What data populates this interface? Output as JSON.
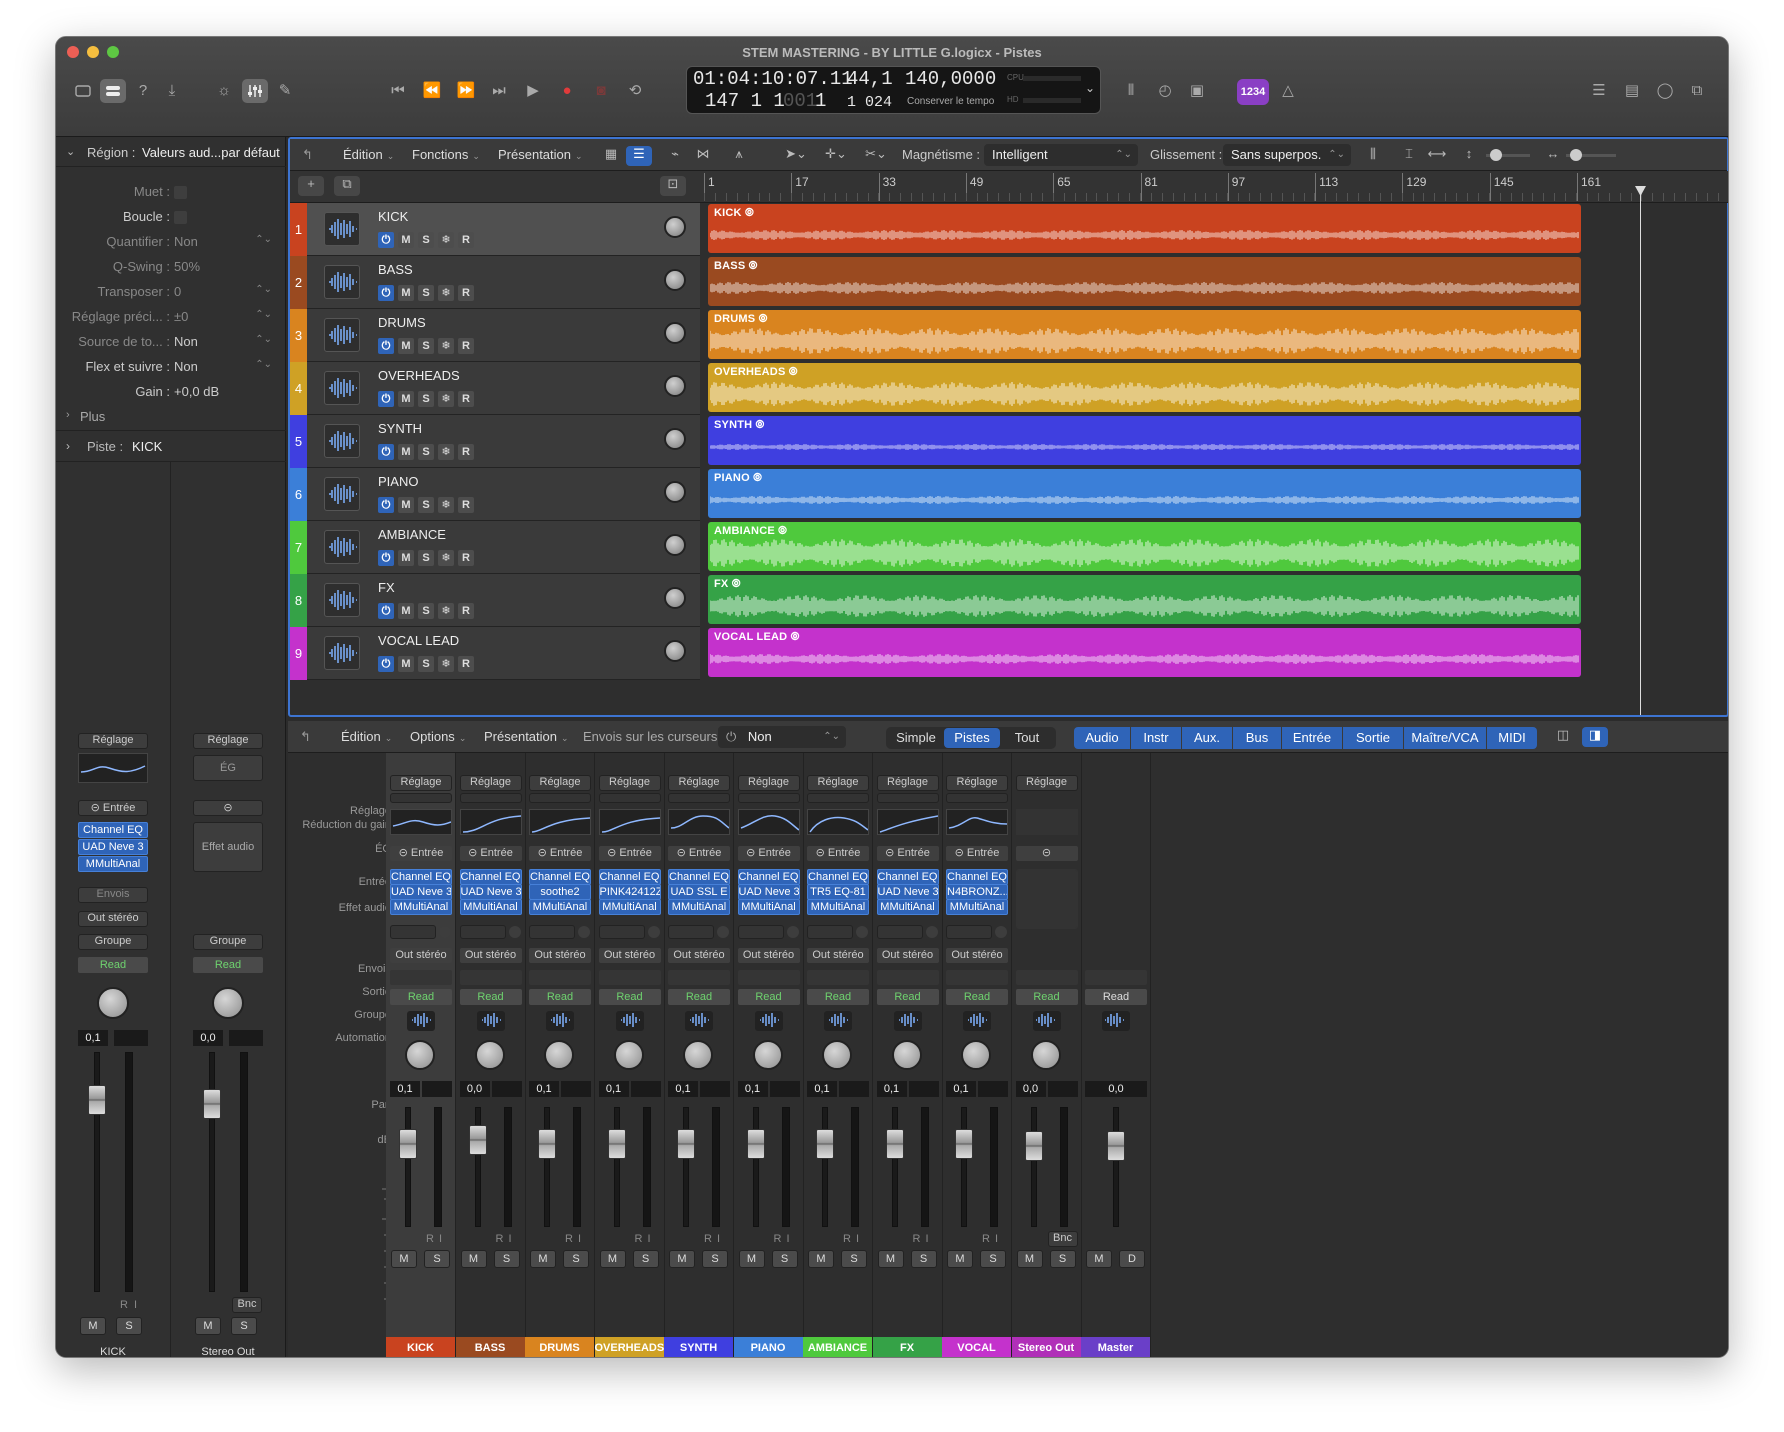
{
  "window": {
    "title": "STEM MASTERING - BY LITTLE G.logicx - Pistes"
  },
  "lcd": {
    "time": "01:04:10:07.11",
    "bars": "147  1  1   001  1",
    "bars_main": "147  1  1",
    "bars_sub": "001",
    "bars_end": "1",
    "key": "44,1",
    "div": "1 024",
    "tempo": "140,0000",
    "tempo_sub": "Conserver le tempo",
    "cpu": "CPU",
    "hd": "HD"
  },
  "toolbar": {
    "count_in": "1234"
  },
  "inspector": {
    "region_header": "Région :",
    "region_name": "Valeurs aud...par défaut",
    "rows": [
      {
        "label": "Muet :",
        "value": ""
      },
      {
        "label": "Boucle :",
        "value": ""
      },
      {
        "label": "Quantifier :",
        "value": "Non"
      },
      {
        "label": "Q-Swing :",
        "value": "50%"
      },
      {
        "label": "Transposer :",
        "value": "0"
      },
      {
        "label": "Réglage préci... :",
        "value": "±0"
      },
      {
        "label": "Source de to... :",
        "value": "Non"
      },
      {
        "label": "Flex et suivre :",
        "value": "Non"
      },
      {
        "label": "Gain :",
        "value": "+0,0 dB"
      }
    ],
    "plus": "Plus",
    "track_header": "Piste :",
    "track_name": "KICK",
    "strip1": {
      "setting": "Réglage",
      "input": "Entrée",
      "plugins": [
        "Channel EQ",
        "UAD Neve 3",
        "MMultiAnal"
      ],
      "sends": "Envois",
      "output": "Out stéréo",
      "group": "Groupe",
      "auto": "Read",
      "vol": "0,1",
      "r": "R",
      "i": "I",
      "m": "M",
      "s": "S",
      "name": "KICK"
    },
    "strip2": {
      "setting": "Réglage",
      "eq": "ÉG",
      "effect": "Effet audio",
      "group": "Groupe",
      "auto": "Read",
      "vol": "0,0",
      "bnc": "Bnc",
      "m": "M",
      "s": "S",
      "name": "Stereo Out"
    }
  },
  "arrange": {
    "menus": [
      "Édition",
      "Fonctions",
      "Présentation"
    ],
    "snap_label": "Magnétisme :",
    "snap_value": "Intelligent",
    "drag_label": "Glissement :",
    "drag_value": "Sans superpos.",
    "ruler": [
      "1",
      "17",
      "33",
      "49",
      "65",
      "81",
      "97",
      "113",
      "129",
      "145",
      "161"
    ],
    "tracks": [
      {
        "num": "1",
        "name": "KICK",
        "color": "#c9431f",
        "num_color": "#c9431f"
      },
      {
        "num": "2",
        "name": "BASS",
        "color": "#9a4a20",
        "num_color": "#9a4a20"
      },
      {
        "num": "3",
        "name": "DRUMS",
        "color": "#d9841f",
        "num_color": "#d9841f"
      },
      {
        "num": "4",
        "name": "OVERHEADS",
        "color": "#cfa125",
        "num_color": "#cfa125"
      },
      {
        "num": "5",
        "name": "SYNTH",
        "color": "#3f3fe0",
        "num_color": "#3f3fe0"
      },
      {
        "num": "6",
        "name": "PIANO",
        "color": "#3b7fd8",
        "num_color": "#3b7fd8"
      },
      {
        "num": "7",
        "name": "AMBIANCE",
        "color": "#4fc93d",
        "num_color": "#4fc93d"
      },
      {
        "num": "8",
        "name": "FX",
        "color": "#35a247",
        "num_color": "#35a247"
      },
      {
        "num": "9",
        "name": "VOCAL LEAD",
        "color": "#c432cc",
        "num_color": "#c432cc"
      }
    ],
    "track_buttons": {
      "m": "M",
      "s": "S",
      "r": "R"
    }
  },
  "mixer": {
    "menus": [
      "Édition",
      "Options",
      "Présentation"
    ],
    "sends_label": "Envois sur les curseurs :",
    "sends_value": "Non",
    "views": [
      "Simple",
      "Pistes",
      "Tout"
    ],
    "filters": [
      "Audio",
      "Instr",
      "Aux.",
      "Bus",
      "Entrée",
      "Sortie",
      "Maître/VCA",
      "MIDI"
    ],
    "row_labels": {
      "setting": "Réglage",
      "gain": "Réduction du gain",
      "eq": "ÉG",
      "input": "Entrée",
      "effect": "Effet audio",
      "sends": "Envois",
      "output": "Sortie",
      "group": "Groupe",
      "auto": "Automation",
      "pan": "Pan",
      "db": "dB"
    },
    "channels": [
      {
        "name": "KICK",
        "color": "#c9431f",
        "fx": [
          "Channel EQ",
          "UAD Neve 3",
          "MMultiAnal"
        ],
        "vol": "0,1",
        "out": "Out stéréo",
        "setting": "Réglage",
        "input": "Entrée",
        "auto": "Read",
        "m": "M",
        "s": "S",
        "r": "R",
        "i": "I"
      },
      {
        "name": "BASS",
        "color": "#9a4a20",
        "fx": [
          "Channel EQ",
          "UAD Neve 3",
          "MMultiAnal"
        ],
        "vol": "0,0",
        "out": "Out stéréo",
        "setting": "Réglage",
        "input": "Entrée",
        "auto": "Read",
        "m": "M",
        "s": "S",
        "r": "R",
        "i": "I"
      },
      {
        "name": "DRUMS",
        "color": "#d9841f",
        "fx": [
          "Channel EQ",
          "soothe2",
          "MMultiAnal"
        ],
        "vol": "0,1",
        "out": "Out stéréo",
        "setting": "Réglage",
        "input": "Entrée",
        "auto": "Read",
        "m": "M",
        "s": "S",
        "r": "R",
        "i": "I"
      },
      {
        "name": "OVERHEADS",
        "color": "#cfa125",
        "fx": [
          "Channel EQ",
          "PINK42412Z",
          "MMultiAnal"
        ],
        "vol": "0,1",
        "out": "Out stéréo",
        "setting": "Réglage",
        "input": "Entrée",
        "auto": "Read",
        "m": "M",
        "s": "S",
        "r": "R",
        "i": "I"
      },
      {
        "name": "SYNTH",
        "color": "#3f3fe0",
        "fx": [
          "Channel EQ",
          "UAD SSL E",
          "MMultiAnal"
        ],
        "vol": "0,1",
        "out": "Out stéréo",
        "setting": "Réglage",
        "input": "Entrée",
        "auto": "Read",
        "m": "M",
        "s": "S",
        "r": "R",
        "i": "I"
      },
      {
        "name": "PIANO",
        "color": "#3b7fd8",
        "fx": [
          "Channel EQ",
          "UAD Neve 3",
          "MMultiAnal"
        ],
        "vol": "0,1",
        "out": "Out stéréo",
        "setting": "Réglage",
        "input": "Entrée",
        "auto": "Read",
        "m": "M",
        "s": "S",
        "r": "R",
        "i": "I"
      },
      {
        "name": "AMBIANCE",
        "color": "#4fc93d",
        "fx": [
          "Channel EQ",
          "TR5 EQ-81",
          "MMultiAnal"
        ],
        "vol": "0,1",
        "out": "Out stéréo",
        "setting": "Réglage",
        "input": "Entrée",
        "auto": "Read",
        "m": "M",
        "s": "S",
        "r": "R",
        "i": "I"
      },
      {
        "name": "FX",
        "color": "#35a247",
        "fx": [
          "Channel EQ",
          "UAD Neve 3",
          "MMultiAnal"
        ],
        "vol": "0,1",
        "out": "Out stéréo",
        "setting": "Réglage",
        "input": "Entrée",
        "auto": "Read",
        "m": "M",
        "s": "S",
        "r": "R",
        "i": "I"
      },
      {
        "name": "VOCAL LEAD",
        "color": "#c432cc",
        "fx": [
          "Channel EQ",
          "N4BRONZ...",
          "MMultiAnal"
        ],
        "vol": "0,1",
        "out": "Out stéréo",
        "setting": "Réglage",
        "input": "Entrée",
        "auto": "Read",
        "m": "M",
        "s": "S",
        "r": "R",
        "i": "I"
      }
    ],
    "stereo_out": {
      "name": "Stereo Out",
      "color": "#b02fb8",
      "setting": "Réglage",
      "vol": "0,0",
      "auto": "Read",
      "bnc": "Bnc",
      "m": "M",
      "s": "S"
    },
    "master": {
      "name": "Master",
      "color": "#6a3fc8",
      "vol": "0,0",
      "auto": "Read",
      "m": "M",
      "d": "D"
    }
  }
}
